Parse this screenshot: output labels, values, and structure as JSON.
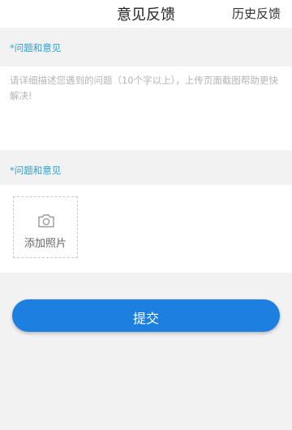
{
  "header": {
    "title": "意见反馈",
    "history_label": "历史反馈"
  },
  "feedback": {
    "section_label": "*问题和意见",
    "placeholder": "请详细描述您遇到的问题（10个字以上），上传页面截图帮助更快解决!"
  },
  "photos": {
    "section_label": "*问题和意见",
    "add_label": "添加照片",
    "icon": "camera-icon"
  },
  "submit": {
    "label": "提交"
  },
  "colors": {
    "accent": "#1d7fe0",
    "label_blue": "#2aa0d6"
  }
}
